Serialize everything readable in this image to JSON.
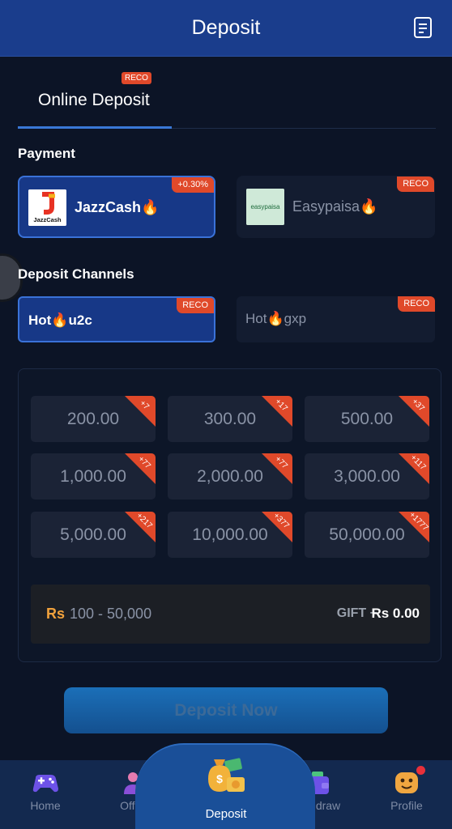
{
  "header": {
    "title": "Deposit",
    "icon": "document-icon"
  },
  "tabs": {
    "online_label": "Online Deposit",
    "online_badge": "RECO"
  },
  "payment": {
    "title": "Payment",
    "methods": [
      {
        "name": "JazzCash🔥",
        "badge": "+0.30%",
        "logo_text": "JazzCash",
        "selected": true
      },
      {
        "name": "Easypaisa🔥",
        "badge": "RECO",
        "logo_text": "easypaisa",
        "selected": false
      }
    ]
  },
  "channels": {
    "title": "Deposit Channels",
    "items": [
      {
        "name": "Hot🔥u2c",
        "badge": "RECO",
        "selected": true
      },
      {
        "name": "Hot🔥gxp",
        "badge": "RECO",
        "selected": false
      }
    ]
  },
  "amounts": [
    {
      "value": "200.00",
      "bonus": "+7"
    },
    {
      "value": "300.00",
      "bonus": "+17"
    },
    {
      "value": "500.00",
      "bonus": "+37"
    },
    {
      "value": "1,000.00",
      "bonus": "+77"
    },
    {
      "value": "2,000.00",
      "bonus": "+77"
    },
    {
      "value": "3,000.00",
      "bonus": "+117"
    },
    {
      "value": "5,000.00",
      "bonus": "+217"
    },
    {
      "value": "10,000.00",
      "bonus": "+377"
    },
    {
      "value": "50,000.00",
      "bonus": "+1777"
    }
  ],
  "range": {
    "currency": "Rs",
    "text": "100 - 50,000",
    "gift_label": "GIFT +",
    "gift_value": "Rs 0.00"
  },
  "deposit_button": "Deposit Now",
  "nav": {
    "items": [
      {
        "label": "Home",
        "icon": "gamepad-icon"
      },
      {
        "label": "Offers",
        "icon": "offers-icon"
      },
      {
        "label": "Deposit",
        "icon": "money-bag-icon"
      },
      {
        "label": "Withdraw",
        "icon": "wallet-icon"
      },
      {
        "label": "Profile",
        "icon": "avatar-icon"
      }
    ]
  },
  "colors": {
    "accent": "#e0492a",
    "header": "#1a3d8c",
    "active_card": "#173887",
    "currency": "#f0a13c"
  }
}
